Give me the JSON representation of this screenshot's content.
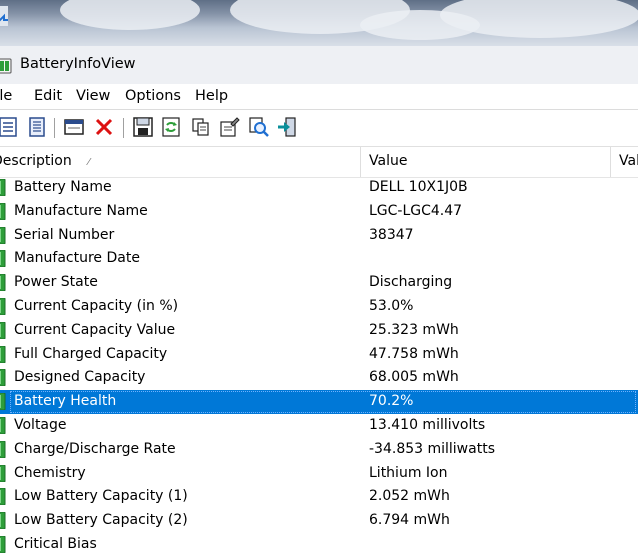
{
  "window": {
    "title": "BatteryInfoView"
  },
  "menu": [
    "File",
    "Edit",
    "View",
    "Options",
    "Help"
  ],
  "toolbar": {
    "buttons": [
      {
        "name": "properties-icon"
      },
      {
        "name": "list-view-icon"
      },
      {
        "name": "window-icon"
      },
      {
        "name": "delete-icon"
      },
      {
        "name": "save-icon"
      },
      {
        "name": "refresh-icon"
      },
      {
        "name": "copy-icon"
      },
      {
        "name": "options-icon"
      },
      {
        "name": "find-icon"
      },
      {
        "name": "exit-icon"
      }
    ]
  },
  "columns": [
    "Description",
    "Value",
    "Val"
  ],
  "rows": [
    {
      "desc": "Battery Name",
      "value": "DELL 10X1J0B"
    },
    {
      "desc": "Manufacture Name",
      "value": "LGC-LGC4.47"
    },
    {
      "desc": "Serial Number",
      "value": "38347"
    },
    {
      "desc": "Manufacture Date",
      "value": ""
    },
    {
      "desc": "Power State",
      "value": "Discharging"
    },
    {
      "desc": "Current Capacity (in %)",
      "value": "53.0%"
    },
    {
      "desc": "Current Capacity Value",
      "value": "25.323 mWh"
    },
    {
      "desc": "Full Charged Capacity",
      "value": "47.758 mWh"
    },
    {
      "desc": "Designed Capacity",
      "value": "68.005 mWh"
    },
    {
      "desc": "Battery Health",
      "value": "70.2%",
      "selected": true
    },
    {
      "desc": "Voltage",
      "value": "13.410 millivolts"
    },
    {
      "desc": "Charge/Discharge Rate",
      "value": "-34.853 milliwatts"
    },
    {
      "desc": "Chemistry",
      "value": "Lithium Ion"
    },
    {
      "desc": "Low Battery Capacity (1)",
      "value": "2.052 mWh"
    },
    {
      "desc": "Low Battery Capacity (2)",
      "value": "6.794 mWh"
    },
    {
      "desc": "Critical Bias",
      "value": ""
    }
  ],
  "colors": {
    "selection": "#0078d7",
    "battery_green": "#2e9e3a"
  }
}
